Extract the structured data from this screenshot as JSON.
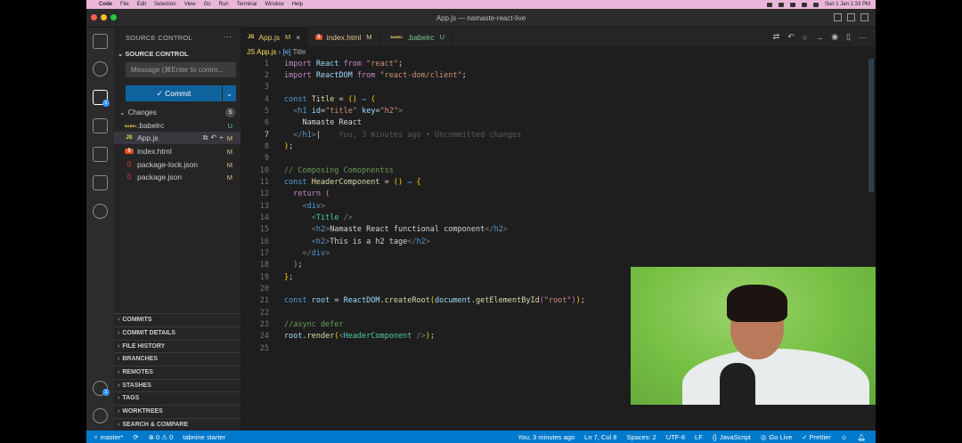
{
  "menubar": {
    "app": "Code",
    "items": [
      "File",
      "Edit",
      "Selection",
      "View",
      "Go",
      "Run",
      "Terminal",
      "Window",
      "Help"
    ],
    "datetime": "Sun 1 Jan  1:33 PM"
  },
  "window": {
    "title": "App.js — namaste-react-live"
  },
  "activity": {
    "source_control_badge": "5",
    "accounts_badge": "1"
  },
  "sidebar": {
    "title": "SOURCE CONTROL",
    "more": "···",
    "section": "SOURCE CONTROL",
    "message_placeholder": "Message (⌘Enter to comm...",
    "commit_label": "✓ Commit",
    "changes_label": "Changes",
    "changes_count": "5",
    "files": [
      {
        "icon": "BABEL",
        "name": ".babelrc",
        "status": "U"
      },
      {
        "icon": "JS",
        "name": "App.js",
        "status": "M"
      },
      {
        "icon": "5",
        "name": "index.html",
        "status": "M"
      },
      {
        "icon": "{}",
        "name": "package-lock.json",
        "status": "M"
      },
      {
        "icon": "{}",
        "name": "package.json",
        "status": "M"
      }
    ],
    "panels": [
      "COMMITS",
      "COMMIT DETAILS",
      "FILE HISTORY",
      "BRANCHES",
      "REMOTES",
      "STASHES",
      "TAGS",
      "WORKTREES",
      "SEARCH & COMPARE"
    ]
  },
  "tabs": [
    {
      "icon": "JS",
      "label": "App.js",
      "status": "M"
    },
    {
      "icon": "5",
      "label": "index.html",
      "status": "M"
    },
    {
      "icon": "BABEL",
      "label": ".babelrc",
      "status": "U"
    }
  ],
  "breadcrumb": {
    "file": "JS App.js",
    "symbol": "Title"
  },
  "editor": {
    "blame": "You, 3 minutes ago • Uncommitted changes"
  },
  "status": {
    "branch": "master*",
    "problems": "⊗ 0 ⚠ 0",
    "tabnine": "tabnine starter",
    "blame": "You, 3 minutes ago",
    "position": "Ln 7, Col 8",
    "spaces": "Spaces: 2",
    "encoding": "UTF-8",
    "eol": "LF",
    "language": "JavaScript",
    "golive": "Go Live",
    "prettier": "✓ Prettier"
  },
  "colors": {
    "accent": "#007acc",
    "commit": "#0e639c",
    "menubar": "#e9b6d9"
  }
}
